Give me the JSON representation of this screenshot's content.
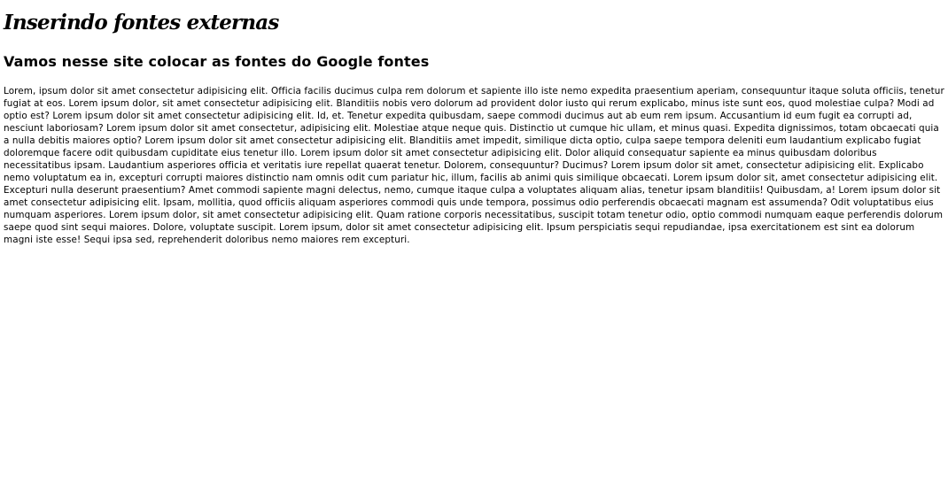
{
  "page": {
    "title": "Inserindo fontes externas",
    "subtitle": "Vamos nesse site colocar as fontes do Google fontes",
    "paragraph": "Lorem, ipsum dolor sit amet consectetur adipisicing elit. Officia facilis ducimus culpa rem dolorum et sapiente illo iste nemo expedita praesentium aperiam, consequuntur itaque soluta officiis, tenetur fugiat at eos. Lorem ipsum dolor, sit amet consectetur adipisicing elit. Blanditiis nobis vero dolorum ad provident dolor iusto qui rerum explicabo, minus iste sunt eos, quod molestiae culpa? Modi ad optio est? Lorem ipsum dolor sit amet consectetur adipisicing elit. Id, et. Tenetur expedita quibusdam, saepe commodi ducimus aut ab eum rem ipsum. Accusantium id eum fugit ea corrupti ad, nesciunt laboriosam? Lorem ipsum dolor sit amet consectetur, adipisicing elit. Molestiae atque neque quis. Distinctio ut cumque hic ullam, et minus quasi. Expedita dignissimos, totam obcaecati quia a nulla debitis maiores optio? Lorem ipsum dolor sit amet consectetur adipisicing elit. Blanditiis amet impedit, similique dicta optio, culpa saepe tempora deleniti eum laudantium explicabo fugiat doloremque facere odit quibusdam cupiditate eius tenetur illo. Lorem ipsum dolor sit amet consectetur adipisicing elit. Dolor aliquid consequatur sapiente ea minus quibusdam doloribus necessitatibus ipsam. Laudantium asperiores officia et veritatis iure repellat quaerat tenetur. Dolorem, consequuntur? Ducimus? Lorem ipsum dolor sit amet, consectetur adipisicing elit. Explicabo nemo voluptatum ea in, excepturi corrupti maiores distinctio nam omnis odit cum pariatur hic, illum, facilis ab animi quis similique obcaecati. Lorem ipsum dolor sit, amet consectetur adipisicing elit. Excepturi nulla deserunt praesentium? Amet commodi sapiente magni delectus, nemo, cumque itaque culpa a voluptates aliquam alias, tenetur ipsam blanditiis! Quibusdam, a! Lorem ipsum dolor sit amet consectetur adipisicing elit. Ipsam, mollitia, quod officiis aliquam asperiores commodi quis unde tempora, possimus odio perferendis obcaecati magnam est assumenda? Odit voluptatibus eius numquam asperiores. Lorem ipsum dolor, sit amet consectetur adipisicing elit. Quam ratione corporis necessitatibus, suscipit totam tenetur odio, optio commodi numquam eaque perferendis dolorum saepe quod sint sequi maiores. Dolore, voluptate suscipit. Lorem ipsum, dolor sit amet consectetur adipisicing elit. Ipsum perspiciatis sequi repudiandae, ipsa exercitationem est sint ea dolorum magni iste esse! Sequi ipsa sed, reprehenderit doloribus nemo maiores rem excepturi."
  },
  "colors": {
    "background": "#ffffff",
    "text": "#000000"
  }
}
